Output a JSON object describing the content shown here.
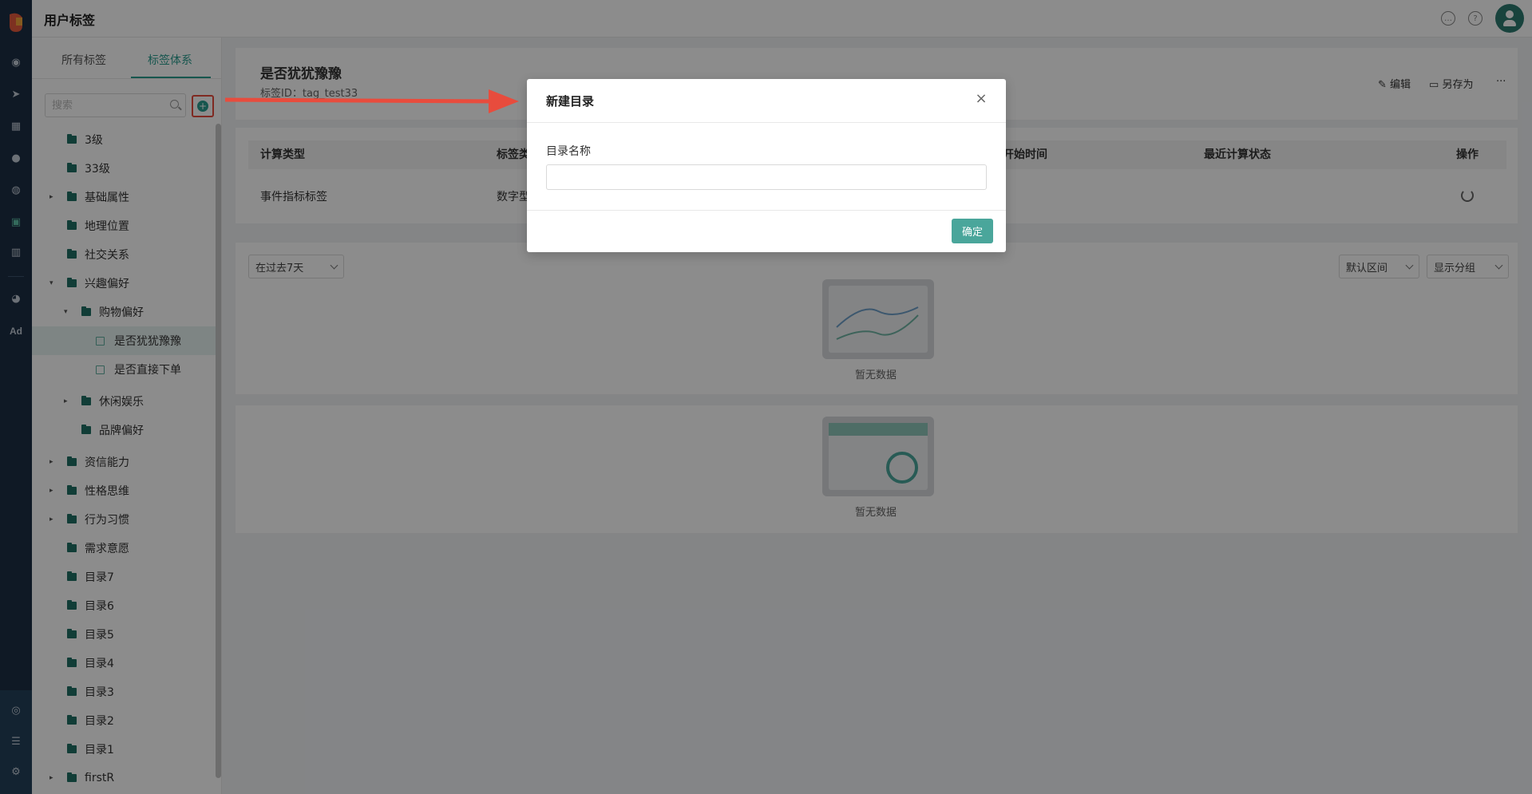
{
  "app": {
    "title": "用户标签"
  },
  "rail": {
    "icons": [
      "dashboard-icon",
      "send-icon",
      "table-icon",
      "user-icon",
      "users-icon",
      "tag-icon",
      "chart-icon",
      "wechat-icon"
    ],
    "ad_label": "Ad",
    "bottom_icons": [
      "eye-icon",
      "server-icon",
      "gear-icon"
    ]
  },
  "header": {
    "icons": [
      "message-icon",
      "help-icon",
      "avatar"
    ]
  },
  "panel": {
    "tabs": [
      {
        "label": "所有标签"
      },
      {
        "label": "标签体系"
      }
    ],
    "active_tab": 1,
    "search_placeholder": "搜索",
    "tree": [
      {
        "label": "3级",
        "level": 0,
        "type": "folder",
        "caret": ""
      },
      {
        "label": "33级",
        "level": 0,
        "type": "folder",
        "caret": ""
      },
      {
        "label": "基础属性",
        "level": 0,
        "type": "folder",
        "caret": "▸"
      },
      {
        "label": "地理位置",
        "level": 0,
        "type": "folder",
        "caret": ""
      },
      {
        "label": "社交关系",
        "level": 0,
        "type": "folder",
        "caret": ""
      },
      {
        "label": "兴趣偏好",
        "level": 0,
        "type": "folder",
        "caret": "▾"
      },
      {
        "label": "购物偏好",
        "level": 1,
        "type": "folder",
        "caret": "▾"
      },
      {
        "label": "是否犹犹豫豫",
        "level": 2,
        "type": "tag",
        "caret": "",
        "selected": true
      },
      {
        "label": "是否直接下单",
        "level": 2,
        "type": "tag",
        "caret": ""
      },
      {
        "label": "休闲娱乐",
        "level": 1,
        "type": "folder",
        "caret": "▸"
      },
      {
        "label": "品牌偏好",
        "level": 1,
        "type": "folder",
        "caret": ""
      },
      {
        "label": "资信能力",
        "level": 0,
        "type": "folder",
        "caret": "▸"
      },
      {
        "label": "性格思维",
        "level": 0,
        "type": "folder",
        "caret": "▸"
      },
      {
        "label": "行为习惯",
        "level": 0,
        "type": "folder",
        "caret": "▸"
      },
      {
        "label": "需求意愿",
        "level": 0,
        "type": "folder",
        "caret": ""
      },
      {
        "label": "目录7",
        "level": 0,
        "type": "folder",
        "caret": ""
      },
      {
        "label": "目录6",
        "level": 0,
        "type": "folder",
        "caret": ""
      },
      {
        "label": "目录5",
        "level": 0,
        "type": "folder",
        "caret": ""
      },
      {
        "label": "目录4",
        "level": 0,
        "type": "folder",
        "caret": ""
      },
      {
        "label": "目录3",
        "level": 0,
        "type": "folder",
        "caret": ""
      },
      {
        "label": "目录2",
        "level": 0,
        "type": "folder",
        "caret": ""
      },
      {
        "label": "目录1",
        "level": 0,
        "type": "folder",
        "caret": ""
      },
      {
        "label": "firstR",
        "level": 0,
        "type": "folder",
        "caret": "▸"
      }
    ]
  },
  "detail": {
    "title": "是否犹犹豫豫",
    "id_text": "标签ID：tag_test33",
    "edit_label": "编辑",
    "save_as_label": "另存为",
    "more_label": "···"
  },
  "table": {
    "headers": [
      "计算类型",
      "标签类",
      "算开始时间",
      "最近计算状态",
      "操作"
    ],
    "row": [
      "事件指标标签",
      "数字型"
    ]
  },
  "filters": {
    "time_range": "在过去7天",
    "interval": "默认区间",
    "group": "显示分组"
  },
  "empty_text": "暂无数据",
  "modal": {
    "title": "新建目录",
    "field_label": "目录名称",
    "field_value": "",
    "ok_label": "确定",
    "close_label": "×"
  },
  "colors": {
    "accent": "#2a9d8f",
    "rail_bg": "#1c2e44",
    "annotation_red": "#e84c3d",
    "primary_button": "#4aa69b"
  }
}
